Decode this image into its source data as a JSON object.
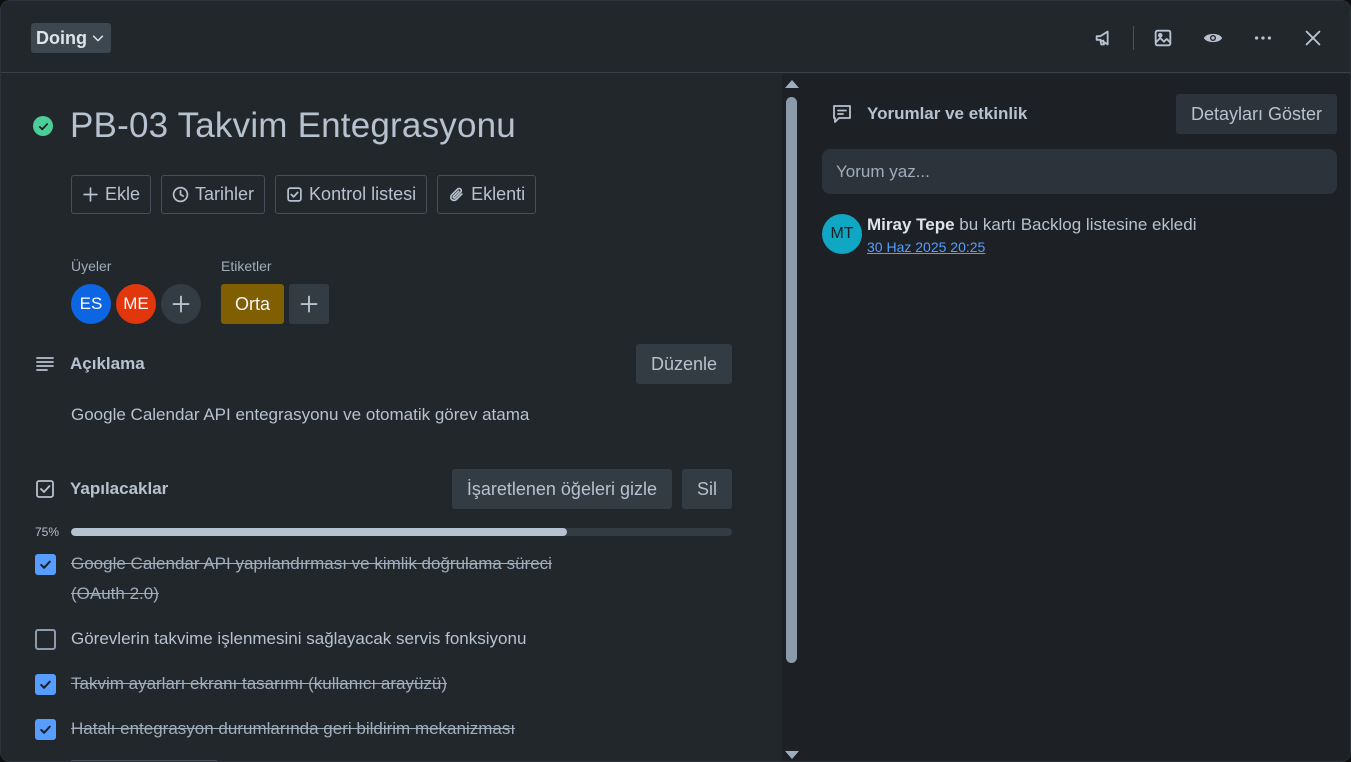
{
  "header": {
    "status": "Doing",
    "icons": [
      "megaphone-icon",
      "image-icon",
      "eye-icon",
      "more-icon",
      "close-icon"
    ]
  },
  "card": {
    "title": "PB-03 Takvim Entegrasyonu",
    "actions": [
      {
        "label": "Ekle",
        "icon": "plus-icon"
      },
      {
        "label": "Tarihler",
        "icon": "clock-icon"
      },
      {
        "label": "Kontrol listesi",
        "icon": "checklist-icon"
      },
      {
        "label": "Eklenti",
        "icon": "paperclip-icon"
      }
    ],
    "members_label": "Üyeler",
    "members": [
      {
        "initials": "ES",
        "color": "#0c66e4"
      },
      {
        "initials": "ME",
        "color": "#e2360c"
      }
    ],
    "labels_label": "Etiketler",
    "labels": [
      {
        "text": "Orta",
        "color": "#7f5f01"
      }
    ]
  },
  "description": {
    "title": "Açıklama",
    "edit_label": "Düzenle",
    "text": "Google Calendar API entegrasyonu ve otomatik görev atama"
  },
  "checklist": {
    "title": "Yapılacaklar",
    "hide_label": "İşaretlenen öğeleri gizle",
    "delete_label": "Sil",
    "progress_label": "75%",
    "progress": 0.75,
    "items": [
      {
        "text": "Google Calendar API yapılandırması ve kimlik doğrulama süreci (OAuth 2.0)",
        "checked": true
      },
      {
        "text": "Görevlerin takvime işlenmesini sağlayacak servis fonksiyonu",
        "checked": false
      },
      {
        "text": "Takvim ayarları ekranı tasarımı (kullanıcı arayüzü)",
        "checked": true
      },
      {
        "text": "Hatalı entegrasyon durumlarında geri bildirim mekanizması",
        "checked": true
      }
    ]
  },
  "activity_panel": {
    "title": "Yorumlar ve etkinlik",
    "details_label": "Detayları Göster",
    "comment_placeholder": "Yorum yaz...",
    "entries": [
      {
        "initials": "MT",
        "user": "Miray Tepe",
        "action": "bu kartı Backlog listesine ekledi",
        "time": "30 Haz 2025 20:25"
      }
    ]
  }
}
